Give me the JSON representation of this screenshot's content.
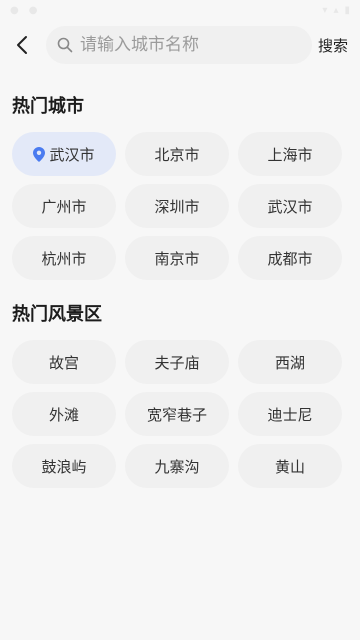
{
  "search": {
    "placeholder": "请输入城市名称",
    "button_label": "搜索"
  },
  "hot_cities": {
    "title": "热门城市",
    "items": [
      {
        "label": "武汉市",
        "selected": true
      },
      {
        "label": "北京市"
      },
      {
        "label": "上海市"
      },
      {
        "label": "广州市"
      },
      {
        "label": "深圳市"
      },
      {
        "label": "武汉市"
      },
      {
        "label": "杭州市"
      },
      {
        "label": "南京市"
      },
      {
        "label": "成都市"
      }
    ]
  },
  "hot_scenic": {
    "title": "热门风景区",
    "items": [
      {
        "label": "故宫"
      },
      {
        "label": "夫子庙"
      },
      {
        "label": "西湖"
      },
      {
        "label": "外滩"
      },
      {
        "label": "宽窄巷子"
      },
      {
        "label": "迪士尼"
      },
      {
        "label": "鼓浪屿"
      },
      {
        "label": "九寨沟"
      },
      {
        "label": "黄山"
      }
    ]
  },
  "colors": {
    "background": "#f7f7f7",
    "chip": "#f0f0f0",
    "chip_selected": "#e3e9f8",
    "location_pin": "#4a7bf0"
  },
  "icons": [
    "back-chevron-icon",
    "search-icon",
    "location-pin-icon"
  ]
}
